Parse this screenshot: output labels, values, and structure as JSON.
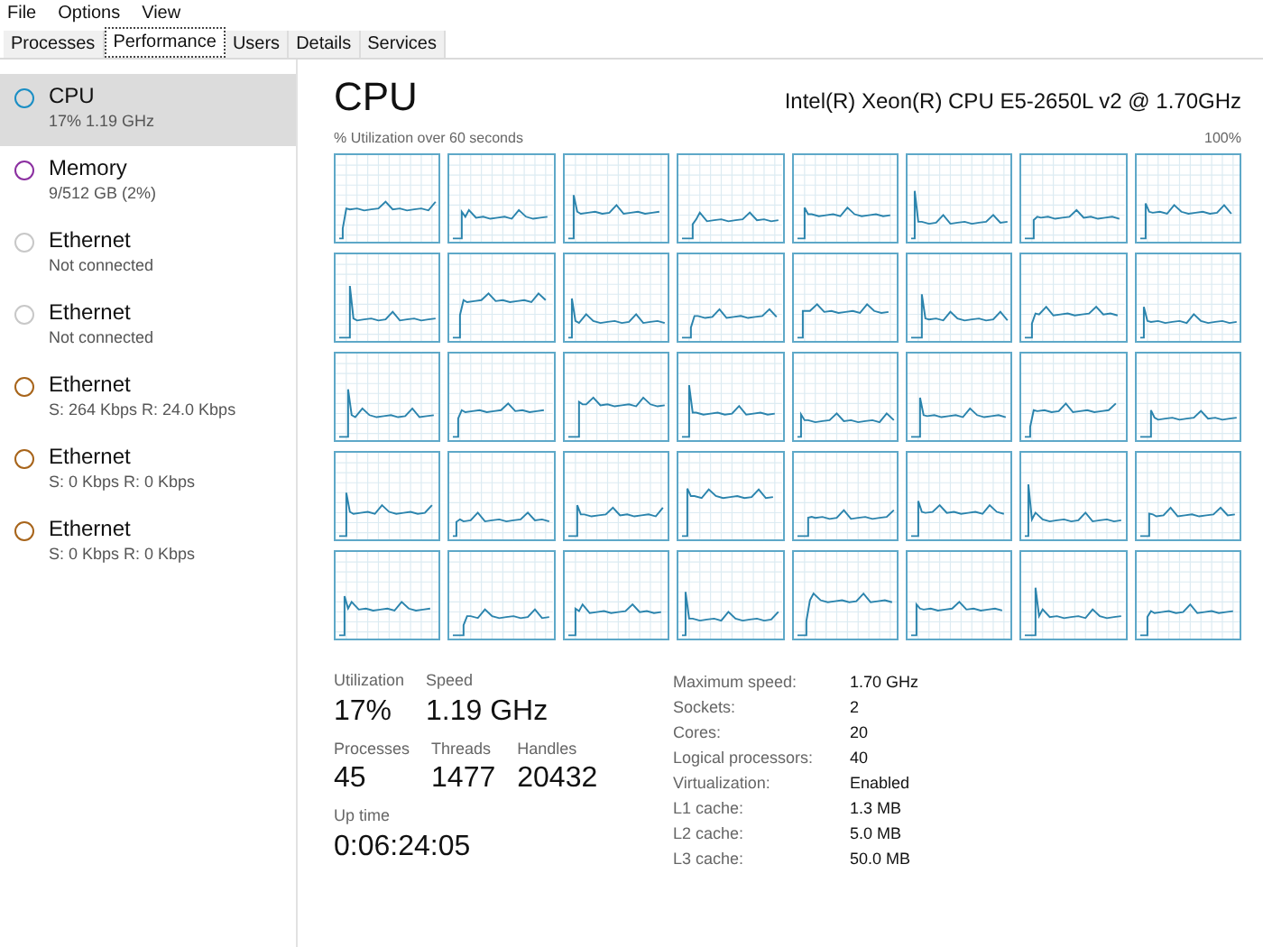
{
  "menu": [
    "File",
    "Options",
    "View"
  ],
  "tabs": [
    {
      "label": "Processes",
      "selected": false
    },
    {
      "label": "Performance",
      "selected": true
    },
    {
      "label": "Users",
      "selected": false
    },
    {
      "label": "Details",
      "selected": false
    },
    {
      "label": "Services",
      "selected": false
    }
  ],
  "sidebar": {
    "items": [
      {
        "title": "CPU",
        "subtitle": "17% 1.19 GHz",
        "color": "#1a8ec4",
        "selected": true
      },
      {
        "title": "Memory",
        "subtitle": "9/512 GB (2%)",
        "color": "#8b2fa0",
        "selected": false
      },
      {
        "title": "Ethernet",
        "subtitle": "Not connected",
        "color": "#c8c8c8",
        "selected": false
      },
      {
        "title": "Ethernet",
        "subtitle": "Not connected",
        "color": "#c8c8c8",
        "selected": false
      },
      {
        "title": "Ethernet",
        "subtitle": "S: 264 Kbps R: 24.0 Kbps",
        "color": "#a7641a",
        "selected": false
      },
      {
        "title": "Ethernet",
        "subtitle": "S: 0 Kbps R: 0 Kbps",
        "color": "#a7641a",
        "selected": false
      },
      {
        "title": "Ethernet",
        "subtitle": "S: 0 Kbps R: 0 Kbps",
        "color": "#a7641a",
        "selected": false
      }
    ]
  },
  "header": {
    "title": "CPU",
    "model": "Intel(R) Xeon(R) CPU E5-2650L v2 @ 1.70GHz"
  },
  "graphs": {
    "caption": "% Utilization over 60 seconds",
    "max_label": "100%"
  },
  "stats": [
    [
      {
        "label": "Utilization",
        "value": "17%"
      },
      {
        "label": "Speed",
        "value": "1.19 GHz"
      }
    ],
    [
      {
        "label": "Processes",
        "value": "45"
      },
      {
        "label": "Threads",
        "value": "1477"
      },
      {
        "label": "Handles",
        "value": "20432"
      }
    ],
    [
      {
        "label": "Up time",
        "value": "0:06:24:05"
      }
    ]
  ],
  "specs": [
    {
      "label": "Maximum speed:",
      "value": "1.70 GHz"
    },
    {
      "label": "Sockets:",
      "value": "2"
    },
    {
      "label": "Cores:",
      "value": "20"
    },
    {
      "label": "Logical processors:",
      "value": "40"
    },
    {
      "label": "Virtualization:",
      "value": "Enabled"
    },
    {
      "label": "L1 cache:",
      "value": "1.3 MB"
    },
    {
      "label": "L2 cache:",
      "value": "5.0 MB"
    },
    {
      "label": "L3 cache:",
      "value": "50.0 MB"
    }
  ]
}
